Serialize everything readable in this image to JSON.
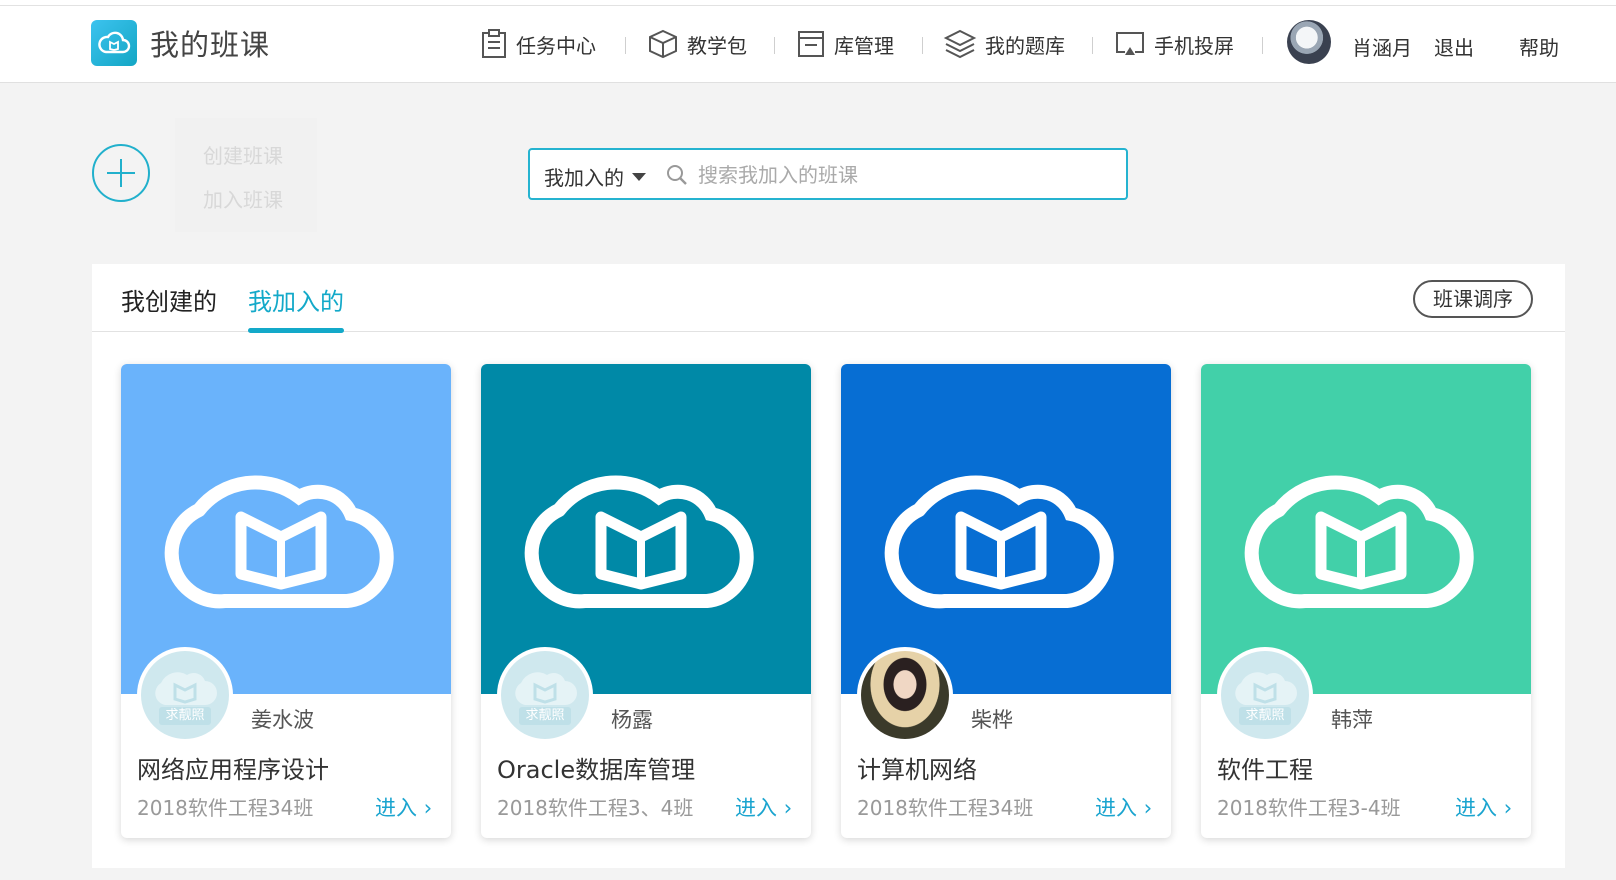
{
  "header": {
    "brand": "我的班课",
    "nav": [
      {
        "label": "任务中心",
        "icon": "clipboard-icon"
      },
      {
        "label": "教学包",
        "icon": "package-box-icon"
      },
      {
        "label": "库管理",
        "icon": "archive-drawer-icon"
      },
      {
        "label": "我的题库",
        "icon": "layers-stack-icon"
      },
      {
        "label": "手机投屏",
        "icon": "screen-cast-icon"
      }
    ],
    "user_name": "肖涵月",
    "logout": "退出",
    "help": "帮助"
  },
  "actions": {
    "create_class": "创建班课",
    "join_class": "加入班课"
  },
  "search": {
    "filter_value": "我加入的",
    "placeholder": "搜索我加入的班课"
  },
  "tabs": [
    {
      "label": "我创建的",
      "active": false
    },
    {
      "label": "我加入的",
      "active": true
    }
  ],
  "reorder_label": "班课调序",
  "colors": {
    "accent": "#13a9c9"
  },
  "cards": [
    {
      "teacher": "姜水波",
      "title": "网络应用程序设计",
      "class": "2018软件工程34班",
      "enter": "进入",
      "cover_color": "#6ab3fb",
      "avatar_text": "求靓照"
    },
    {
      "teacher": "杨露",
      "title": "Oracle数据库管理",
      "class": "2018软件工程3、4班",
      "enter": "进入",
      "cover_color": "#0089a7",
      "avatar_text": "求靓照"
    },
    {
      "teacher": "柴桦",
      "title": "计算机网络",
      "class": "2018软件工程34班",
      "enter": "进入",
      "cover_color": "#076ed3",
      "avatar_text": ""
    },
    {
      "teacher": "韩萍",
      "title": "软件工程",
      "class": "2018软件工程3-4班",
      "enter": "进入",
      "cover_color": "#42d0a9",
      "avatar_text": "求靓照"
    }
  ]
}
